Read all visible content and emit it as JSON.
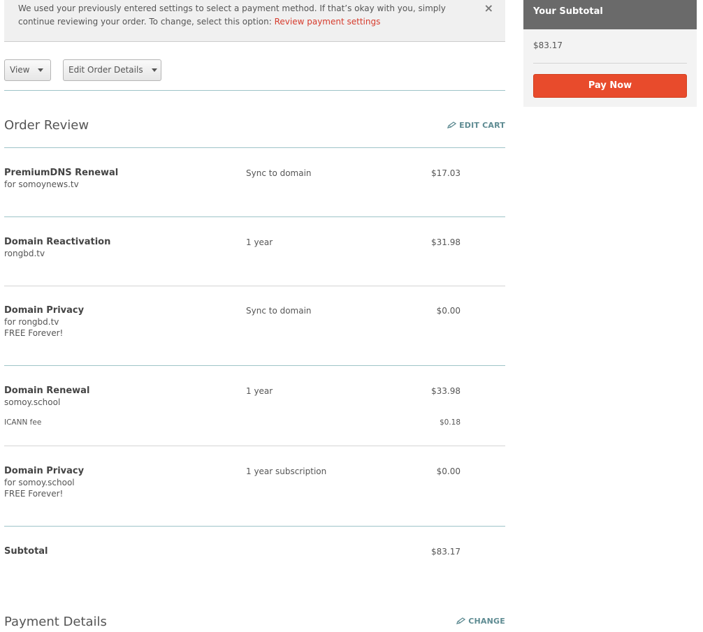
{
  "notice": {
    "text": "We used your previously entered settings to select a payment method. If that’s okay with you, simply continue reviewing your order. To change, select this option:",
    "link": "Review payment settings",
    "close": "×"
  },
  "toolbar": {
    "view_label": "View",
    "edit_order_label": "Edit Order Details"
  },
  "order_review": {
    "title": "Order Review",
    "edit_cart": "EDIT CART",
    "items": [
      {
        "name": "PremiumDNS Renewal",
        "sub1": "for somoynews.tv",
        "term": "Sync to domain",
        "price": "$17.03"
      },
      {
        "name": "Domain Reactivation",
        "sub1": "rongbd.tv",
        "term": "1 year",
        "price": "$31.98"
      },
      {
        "name": "Domain Privacy",
        "sub1": "for rongbd.tv",
        "sub2": "FREE Forever!",
        "term": "Sync to domain",
        "price": "$0.00"
      },
      {
        "name": "Domain Renewal",
        "sub1": "somoy.school",
        "term": "1 year",
        "price": "$33.98",
        "fee_label": "ICANN fee",
        "fee_price": "$0.18"
      },
      {
        "name": "Domain Privacy",
        "sub1": "for somoy.school",
        "sub2": "FREE Forever!",
        "term": "1 year subscription",
        "price": "$0.00"
      }
    ],
    "subtotal_label": "Subtotal",
    "subtotal_value": "$83.17"
  },
  "payment_details": {
    "title": "Payment Details",
    "change": "CHANGE"
  },
  "sidebar": {
    "title": "Your Subtotal",
    "amount": "$83.17",
    "pay_now": "Pay Now"
  },
  "colors": {
    "accent": "#e84b2c",
    "link": "#d63b2c",
    "teal": "#5e8b92",
    "sidebar_head": "#6a6a6a"
  }
}
